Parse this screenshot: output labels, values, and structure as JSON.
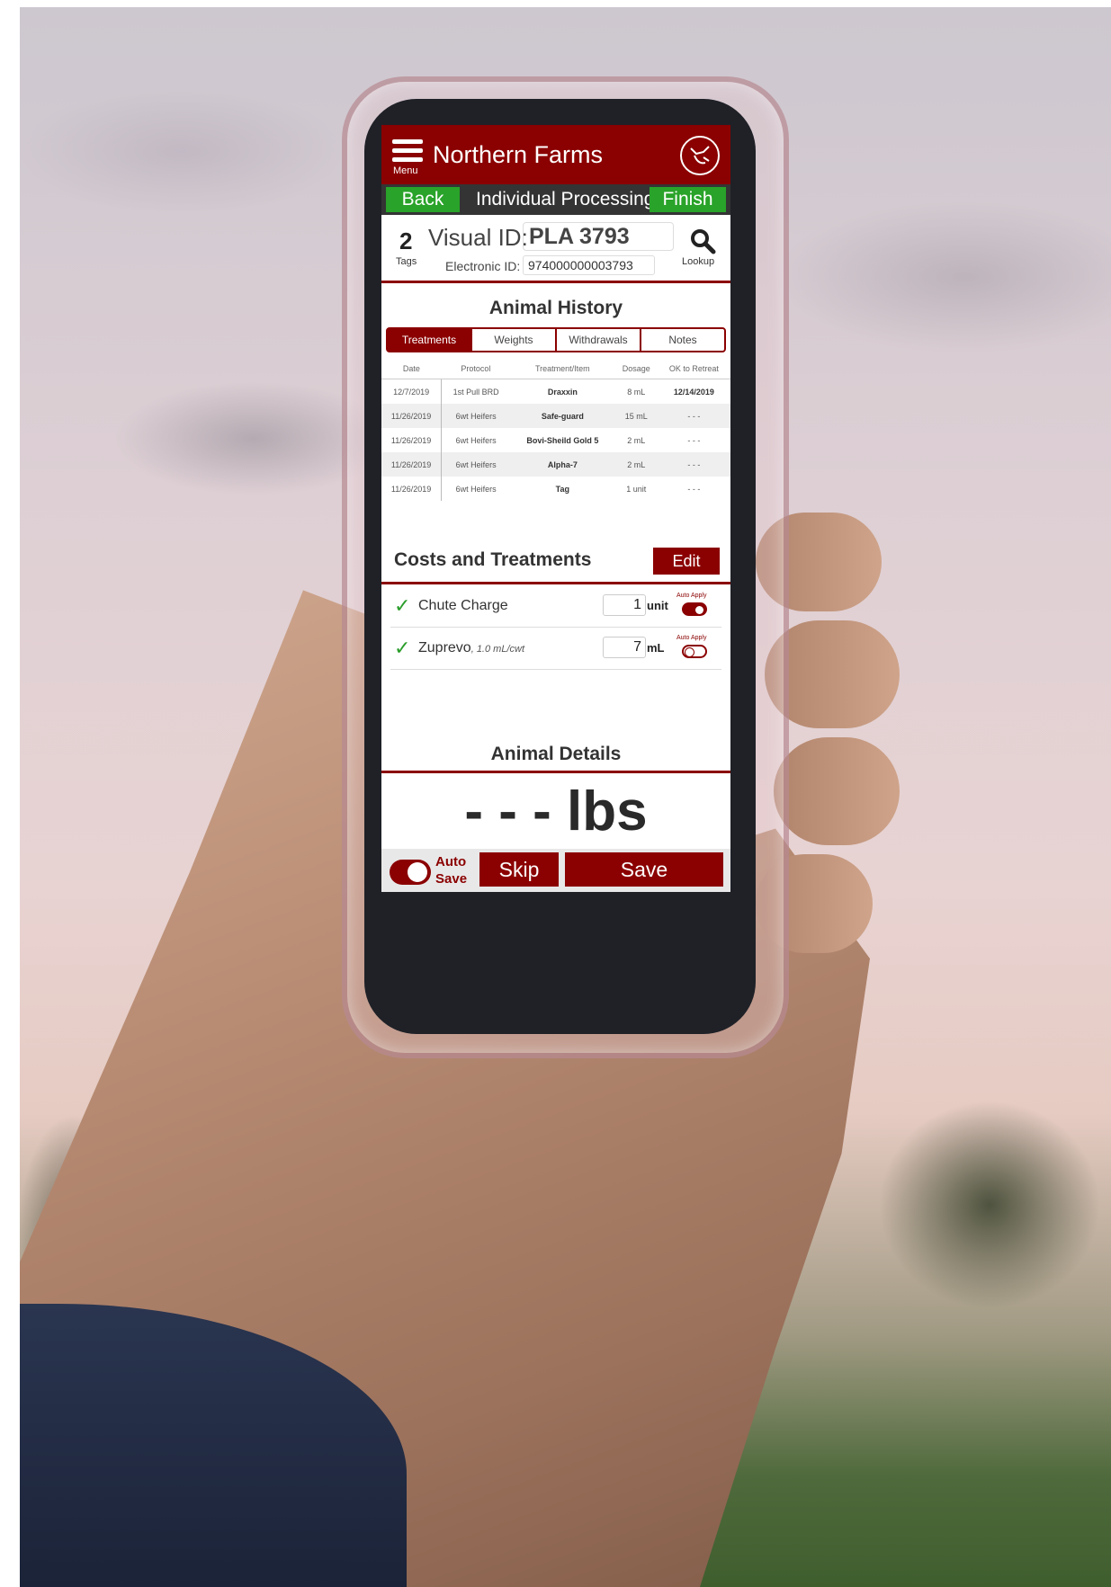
{
  "header": {
    "menu_label": "Menu",
    "farm_name": "Northern Farms"
  },
  "nav": {
    "back_label": "Back",
    "title": "Individual Processing",
    "finish_label": "Finish"
  },
  "animal": {
    "tag_count": "2",
    "tags_label": "Tags",
    "visual_id_label": "Visual ID:",
    "visual_id_value": "PLA 3793",
    "electronic_id_label": "Electronic ID:",
    "electronic_id_value": "974000000003793",
    "lookup_label": "Lookup"
  },
  "history": {
    "title": "Animal History",
    "tabs": [
      {
        "label": "Treatments",
        "active": true
      },
      {
        "label": "Weights",
        "active": false
      },
      {
        "label": "Withdrawals",
        "active": false
      },
      {
        "label": "Notes",
        "active": false
      }
    ],
    "columns": [
      "Date",
      "Protocol",
      "Treatment/Item",
      "Dosage",
      "OK to Retreat"
    ],
    "rows": [
      [
        "12/7/2019",
        "1st Pull BRD",
        "Draxxin",
        "8 mL",
        "12/14/2019"
      ],
      [
        "11/26/2019",
        "6wt Heifers",
        "Safe-guard",
        "15 mL",
        "- - -"
      ],
      [
        "11/26/2019",
        "6wt Heifers",
        "Bovi-Sheild Gold 5",
        "2 mL",
        "- - -"
      ],
      [
        "11/26/2019",
        "6wt Heifers",
        "Alpha-7",
        "2 mL",
        "- - -"
      ],
      [
        "11/26/2019",
        "6wt Heifers",
        "Tag",
        "1 unit",
        "- - -"
      ]
    ]
  },
  "costs": {
    "title": "Costs and Treatments",
    "edit_label": "Edit",
    "items": [
      {
        "name": "Chute Charge",
        "note": "",
        "qty": "1",
        "unit": "unit",
        "auto_apply_label": "Auto Apply",
        "auto_apply": true
      },
      {
        "name": "Zuprevo",
        "note": ", 1.0 mL/cwt",
        "qty": "7",
        "unit": "mL",
        "auto_apply_label": "Auto Apply",
        "auto_apply": false
      }
    ]
  },
  "details": {
    "title": "Animal Details",
    "weight_text": "- - - lbs"
  },
  "footer": {
    "auto_save_line1": "Auto",
    "auto_save_line2": "Save",
    "skip_label": "Skip",
    "save_label": "Save"
  },
  "colors": {
    "brand": "#8b0000",
    "accent_green": "#29a329",
    "nav_dark": "#343434"
  }
}
